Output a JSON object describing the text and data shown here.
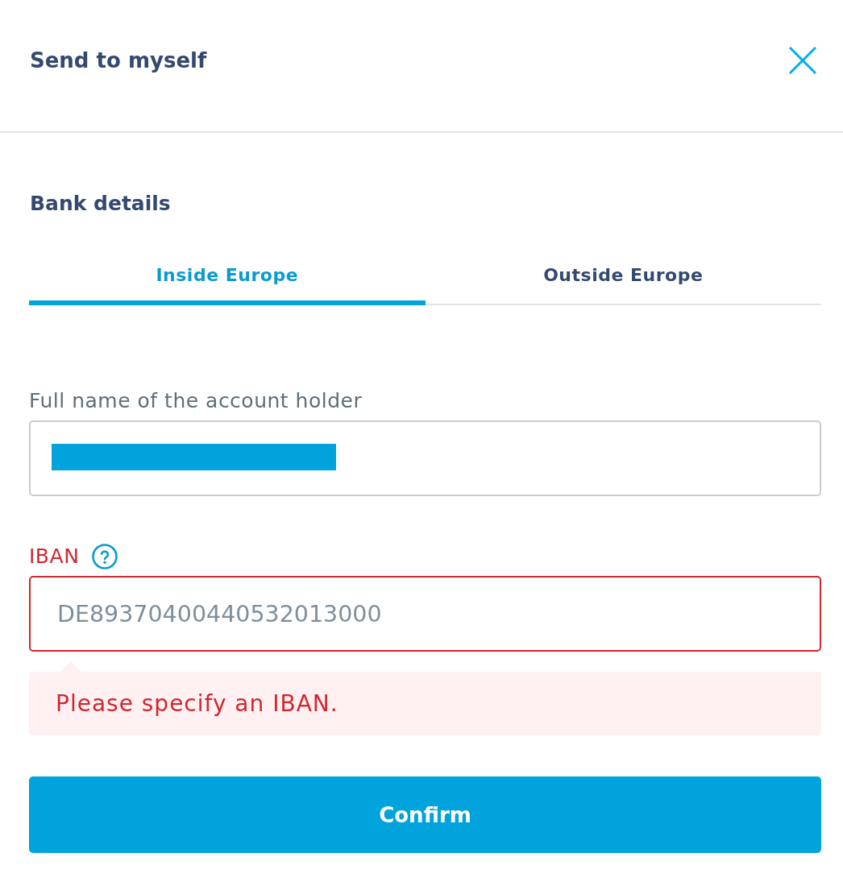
{
  "dialog": {
    "title": "Send to myself"
  },
  "section_title": "Bank details",
  "tabs": [
    {
      "label": "Inside Europe",
      "selected": true
    },
    {
      "label": "Outside Europe",
      "selected": false
    }
  ],
  "fields": [
    {
      "label": "Full name of the account holder",
      "help": false,
      "redacted": true,
      "invalid": false
    },
    {
      "label": "IBAN",
      "help": true,
      "redacted": false,
      "placeholder": "DE89370400440532013000",
      "invalid": true,
      "error": "Please specify an IBAN."
    }
  ],
  "confirm_button": {
    "label": "Confirm"
  }
}
